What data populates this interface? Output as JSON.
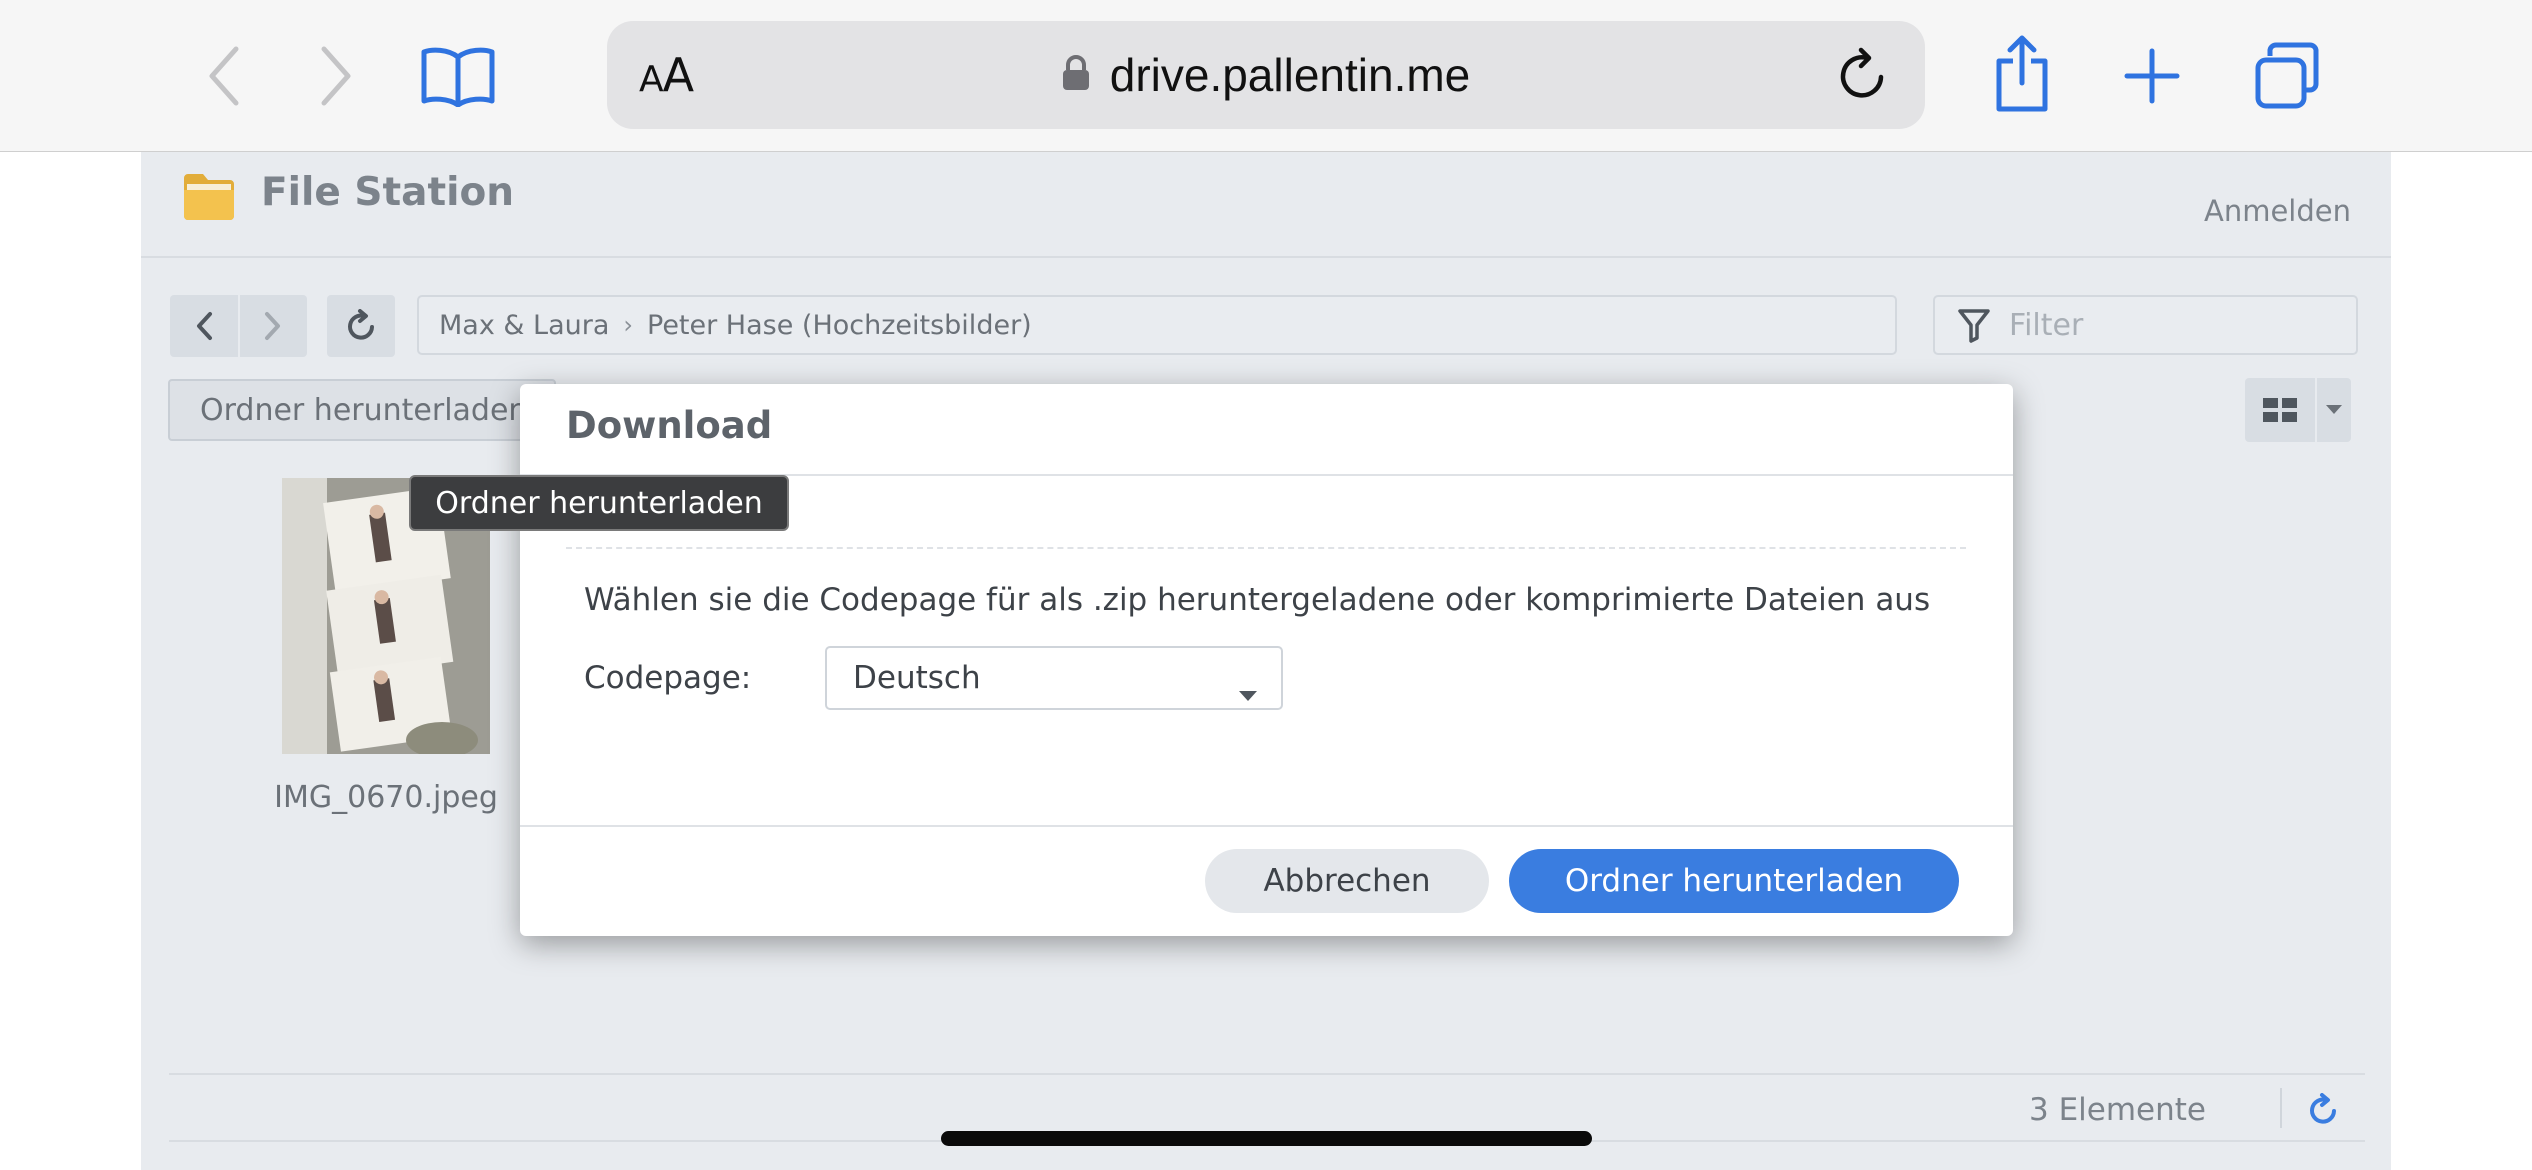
{
  "browser": {
    "text_size_label_small": "A",
    "text_size_label_large": "A",
    "url": "drive.pallentin.me",
    "accent_color": "#2f73e0"
  },
  "app": {
    "title": "File Station",
    "login_label": "Anmelden"
  },
  "toolbar": {
    "breadcrumb": [
      "Max & Laura",
      "Peter Hase (Hochzeitsbilder)"
    ],
    "filter_placeholder": "Filter",
    "download_folder_label": "Ordner herunterladen"
  },
  "files": [
    {
      "name": "IMG_0670.jpeg"
    }
  ],
  "tooltip": {
    "text": "Ordner herunterladen"
  },
  "dialog": {
    "title": "Download",
    "description": "Wählen sie die Codepage für als .zip heruntergeladene oder komprimierte Dateien aus",
    "codepage_label": "Codepage:",
    "codepage_value": "Deutsch",
    "cancel_label": "Abbrechen",
    "confirm_label": "Ordner herunterladen",
    "confirm_color": "#3a7de0"
  },
  "footer": {
    "item_count": "3 Elemente"
  }
}
